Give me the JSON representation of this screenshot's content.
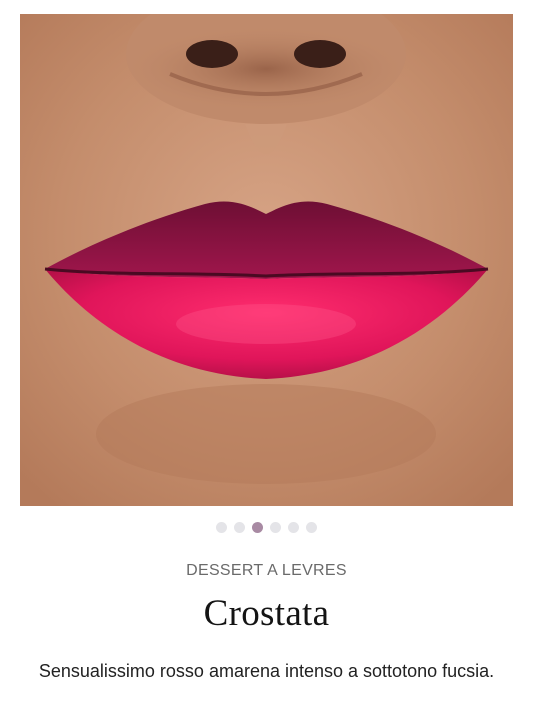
{
  "gallery": {
    "image_subject": "lips wearing lipstick",
    "slide_count": 6,
    "active_slide_index": 2
  },
  "product": {
    "collection": "DESSERT A LEVRES",
    "name": "Crostata",
    "description": "Sensualissimo rosso amarena intenso a sottotono fucsia."
  },
  "colors": {
    "dot_inactive": "#e4e4e8",
    "dot_active": "#a88aa3",
    "lip_upper": "#8c1444",
    "lip_lower": "#e8195e"
  }
}
